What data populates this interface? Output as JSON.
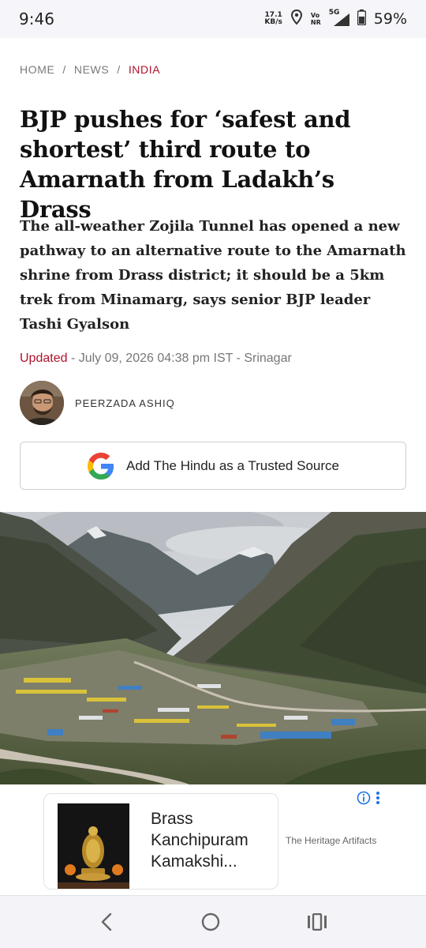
{
  "status_bar": {
    "time": "9:46",
    "net_speed_value": "17.1",
    "net_speed_unit": "KB/s",
    "volte_top": "Vo",
    "volte_bottom": "NR",
    "network": "5G",
    "battery": "59%"
  },
  "breadcrumb": {
    "home": "HOME",
    "news": "NEWS",
    "current": "INDIA",
    "separator": "/"
  },
  "article": {
    "headline": "BJP pushes for ‘safest and shortest’ third route to Amarnath from Ladakh’s Drass",
    "summary": "The all-weather Zojila Tunnel has opened a new pathway to an alternative route to the Amarnath shrine from Drass district; it should be a 5km trek from Minamarg, says senior BJP leader Tashi Gyalson",
    "updated_label": "Updated",
    "updated_rest": " - July 09, 2026 04:38 pm IST - Srinagar",
    "author": "PEERZADA ASHIQ"
  },
  "trusted_source": {
    "label": "Add The Hindu as a Trusted Source"
  },
  "ad": {
    "title": "Brass Kanchipuram Kamakshi...",
    "source": "The Heritage Artifacts"
  },
  "colors": {
    "accent": "#b0122b",
    "status_bar_bg": "#f6f6fa",
    "nav_bar_bg": "#f4f4f8",
    "ad_info": "#1a73e8"
  },
  "icons": {
    "status": [
      "location-icon",
      "signal-icon",
      "battery-icon"
    ],
    "nav": [
      "back-icon",
      "home-icon",
      "recents-icon"
    ],
    "ad": [
      "info-icon",
      "more-icon"
    ],
    "button": "google-logo-icon"
  }
}
